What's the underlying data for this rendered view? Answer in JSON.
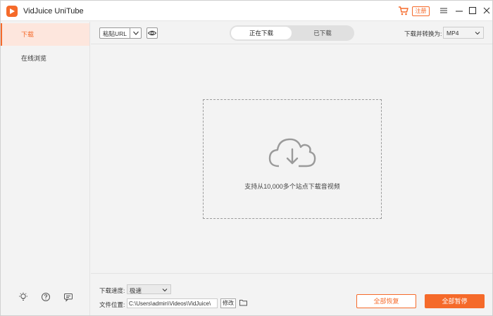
{
  "app": {
    "title": "VidJuice UniTube",
    "register_label": "注册",
    "brand_color": "#f56a2a"
  },
  "sidebar": {
    "items": [
      {
        "label": "下载",
        "active": true
      },
      {
        "label": "在线浏览",
        "active": false
      }
    ],
    "footer_icons": [
      "bulb-icon",
      "help-icon",
      "feedback-icon"
    ]
  },
  "toolbar": {
    "paste_label": "粘贴URL",
    "tabs": [
      {
        "label": "正在下载",
        "active": true
      },
      {
        "label": "已下载",
        "active": false
      }
    ],
    "convert_label": "下载并转换为:",
    "format_value": "MP4"
  },
  "dropzone": {
    "text": "支持从10,000多个站点下载音视频",
    "icon": "cloud-download-icon"
  },
  "footer": {
    "speed_label": "下载速度:",
    "speed_value": "极速",
    "location_label": "文件位置:",
    "path_value": "C:\\Users\\admin\\Videos\\VidJuice\\",
    "modify_label": "修改",
    "resume_all_label": "全部恢复",
    "pause_all_label": "全部暂停"
  }
}
